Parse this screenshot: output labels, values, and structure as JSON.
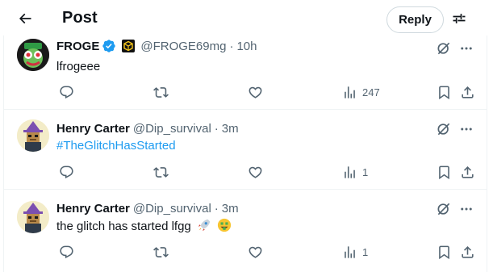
{
  "header": {
    "title": "Post",
    "reply_label": "Reply"
  },
  "tweets": [
    {
      "name": "FROGE",
      "handle": "@FROGE69mg",
      "separator": "·",
      "time": "10h",
      "text": "lfrogeee",
      "views": "247",
      "verified": true,
      "avatar": "frog-avatar"
    },
    {
      "name": "Henry Carter",
      "handle": "@Dip_survival",
      "separator": "·",
      "time": "3m",
      "text": "#TheGlitchHasStarted",
      "views": "1",
      "avatar": "pixel-wizard-avatar"
    },
    {
      "name": "Henry Carter",
      "handle": "@Dip_survival",
      "separator": "·",
      "time": "3m",
      "text": "the glitch has started lfgg",
      "emojis": [
        "rocket",
        "money-mouth-face"
      ],
      "views": "1",
      "avatar": "pixel-wizard-avatar"
    }
  ],
  "colors": {
    "accent": "#1d9bf0",
    "secondary_text": "#536471",
    "border": "#eff3f4"
  }
}
